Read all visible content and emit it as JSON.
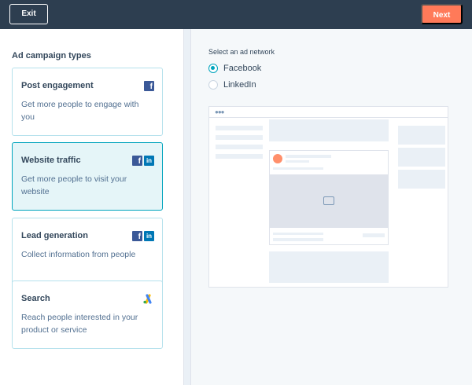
{
  "header": {
    "exit_label": "Exit",
    "next_label": "Next"
  },
  "sidebar": {
    "title": "Ad campaign types",
    "cards": [
      {
        "title": "Post engagement",
        "description": "Get more people to engage with you",
        "networks": [
          "facebook"
        ]
      },
      {
        "title": "Website traffic",
        "description": "Get more people to visit your website",
        "networks": [
          "facebook",
          "linkedin"
        ],
        "selected": true
      },
      {
        "title": "Lead generation",
        "description": "Collect information from people",
        "networks": [
          "facebook",
          "linkedin"
        ]
      },
      {
        "title": "Search",
        "description": "Reach people interested in your product or service",
        "networks": [
          "google-ads"
        ]
      }
    ]
  },
  "network": {
    "title": "Select an ad network",
    "options": [
      {
        "label": "Facebook",
        "checked": true
      },
      {
        "label": "LinkedIn",
        "checked": false
      }
    ]
  },
  "preview": {
    "sponsored_label": "Sponsored"
  },
  "icons": {
    "facebook": "facebook-icon",
    "linkedin": "linkedin-icon",
    "google_ads": "google-ads-icon",
    "image": "image-icon"
  },
  "colors": {
    "topbar": "#2d3e50",
    "accent": "#00a4bd",
    "next_button": "#ff7a59",
    "selected_card": "#e5f5f8"
  }
}
